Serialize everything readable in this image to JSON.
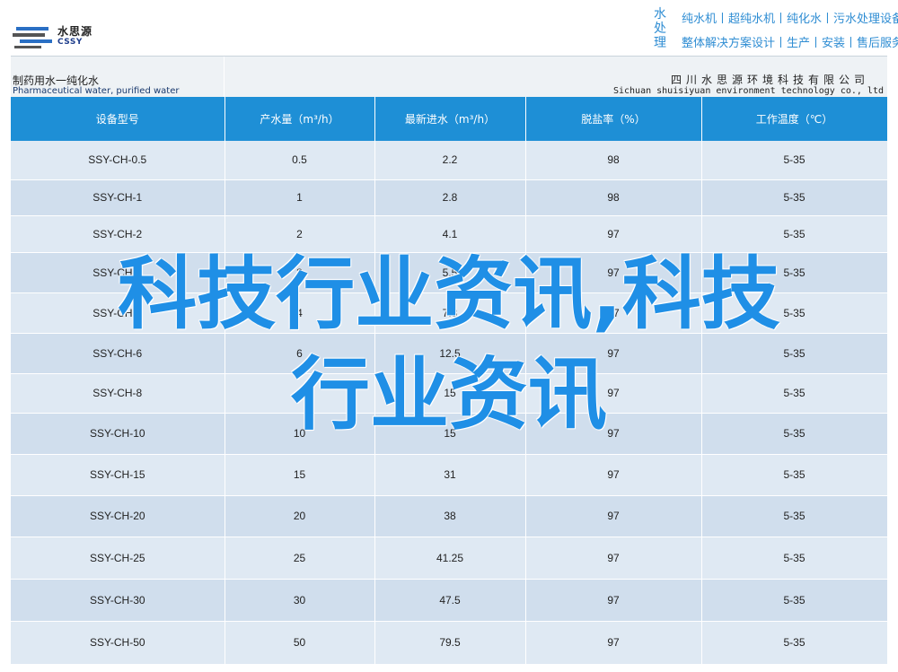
{
  "logo": {
    "name_cn": "水思源",
    "name_en": "CSSY"
  },
  "promo": {
    "vertical": "水处理",
    "line1": "纯水机丨超纯水机丨纯化水丨污水处理设备",
    "line2": "整体解决方案设计丨生产丨安装丨售后服务"
  },
  "band": {
    "title_cn": "制药用水一纯化水",
    "title_en": "Pharmaceutical water, purified water",
    "company_cn": "四川水思源环境科技有限公司",
    "company_en": "Sichuan shuisiyuan environment technology co., ltd"
  },
  "table": {
    "headers": [
      "设备型号",
      "产水量（m³/h）",
      "最新进水（m³/h）",
      "脱盐率（%）",
      "工作温度（℃）"
    ],
    "rows": [
      [
        "SSY-CH-0.5",
        "0.5",
        "2.2",
        "98",
        "5-35"
      ],
      [
        "SSY-CH-1",
        "1",
        "2.8",
        "98",
        "5-35"
      ],
      [
        "SSY-CH-2",
        "2",
        "4.1",
        "97",
        "5-35"
      ],
      [
        "SSY-CH-3",
        "3",
        "5.5",
        "97",
        "5-35"
      ],
      [
        "SSY-CH-4",
        "4",
        "7.3",
        "97",
        "5-35"
      ],
      [
        "SSY-CH-6",
        "6",
        "12.5",
        "97",
        "5-35"
      ],
      [
        "SSY-CH-8",
        "8",
        "15",
        "97",
        "5-35"
      ],
      [
        "SSY-CH-10",
        "10",
        "15",
        "97",
        "5-35"
      ],
      [
        "SSY-CH-15",
        "15",
        "31",
        "97",
        "5-35"
      ],
      [
        "SSY-CH-20",
        "20",
        "38",
        "97",
        "5-35"
      ],
      [
        "SSY-CH-25",
        "25",
        "41.25",
        "97",
        "5-35"
      ],
      [
        "SSY-CH-30",
        "30",
        "47.5",
        "97",
        "5-35"
      ],
      [
        "SSY-CH-50",
        "50",
        "79.5",
        "97",
        "5-35"
      ]
    ]
  },
  "overlay": {
    "line1": "科技行业资讯,科技",
    "line2": "行业资讯"
  },
  "colors": {
    "header_bg": "#1e8fd6",
    "row_light": "#dfe9f3",
    "row_dark": "#d0deed",
    "overlay": "#1f8fe6"
  }
}
